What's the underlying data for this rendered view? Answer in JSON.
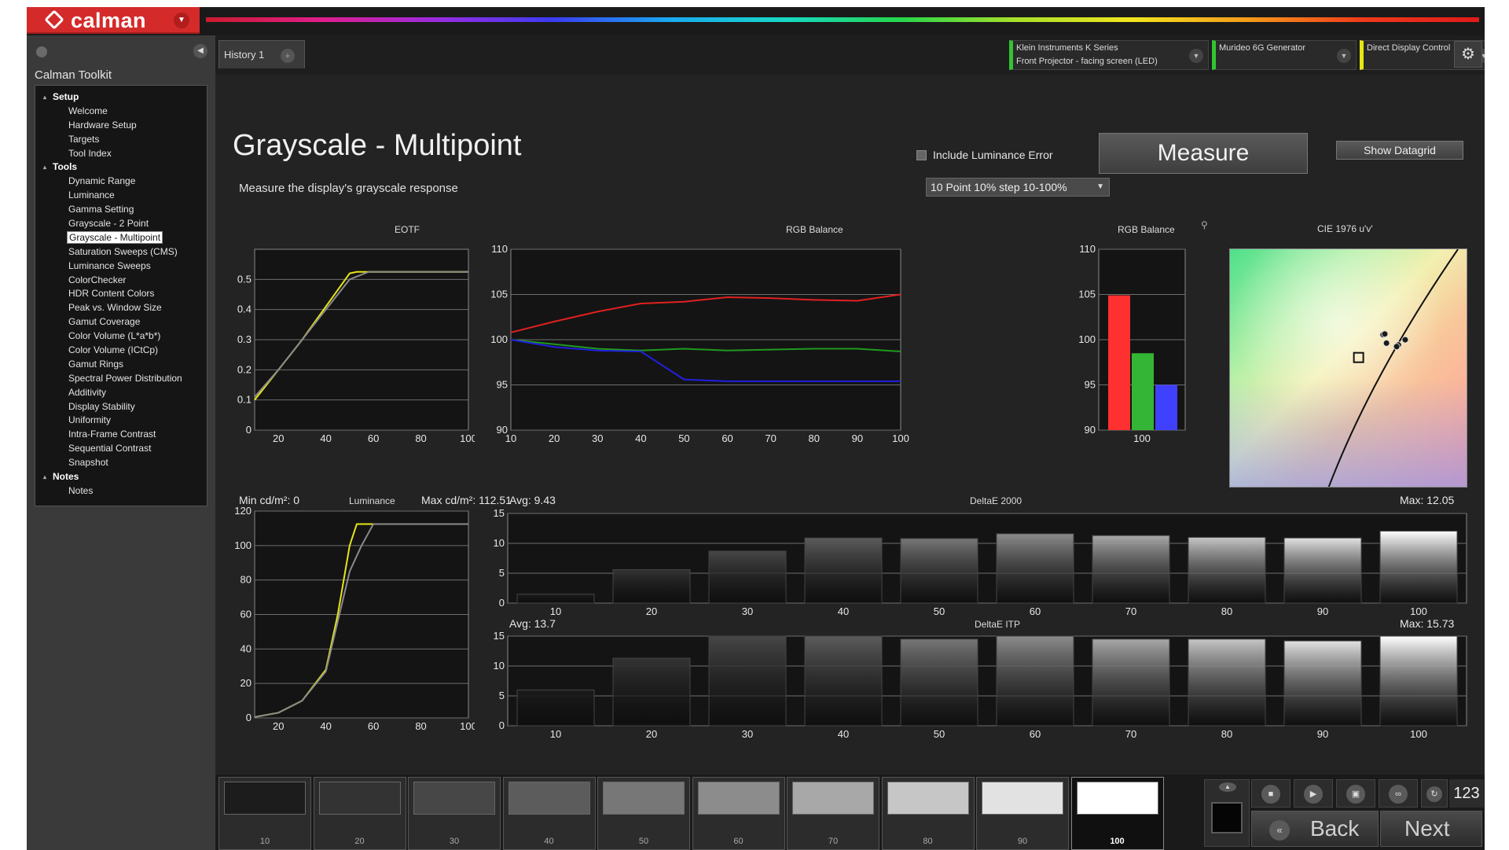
{
  "app": {
    "logo_text": "calman"
  },
  "toolkit": {
    "title": "Calman Toolkit",
    "groups": [
      {
        "label": "Setup",
        "items": [
          "Welcome",
          "Hardware Setup",
          "Targets",
          "Tool Index"
        ]
      },
      {
        "label": "Tools",
        "items": [
          "Dynamic Range",
          "Luminance",
          "Gamma Setting",
          "Grayscale - 2 Point",
          "Grayscale - Multipoint",
          "Saturation Sweeps (CMS)",
          "Luminance Sweeps",
          "ColorChecker",
          "HDR Content Colors",
          "Peak vs. Window Size",
          "Gamut Coverage",
          "Color Volume (L*a*b*)",
          "Color Volume (ICtCp)",
          "Gamut Rings",
          "Spectral Power Distribution",
          "Additivity",
          "Display Stability",
          "Uniformity",
          "Intra-Frame Contrast",
          "Sequential Contrast",
          "Snapshot"
        ]
      },
      {
        "label": "Notes",
        "items": [
          "Notes"
        ]
      }
    ],
    "selected": "Grayscale - Multipoint"
  },
  "tabs": {
    "history": "History 1",
    "add": "+"
  },
  "devices": [
    {
      "line1": "Klein Instruments K Series",
      "line2": "Front Projector - facing screen (LED)",
      "color": "#31c531"
    },
    {
      "line1": "Murideo 6G Generator",
      "line2": "",
      "color": "#31c531"
    },
    {
      "line1": "Direct Display Control",
      "line2": "",
      "color": "#e6e617"
    }
  ],
  "page": {
    "title": "Grayscale - Multipoint",
    "subtitle": "Measure the display's grayscale response",
    "include_luminance_error": "Include Luminance Error",
    "measure_button": "Measure",
    "datagrid_button": "Show Datagrid",
    "point_select": "10 Point 10% step 10-100%"
  },
  "charts": {
    "eotf": {
      "title": "EOTF",
      "y_ticks": [
        "0",
        "0.1",
        "0.2",
        "0.3",
        "0.4",
        "0.5"
      ],
      "x_ticks": [
        "20",
        "40",
        "60",
        "80",
        "100"
      ]
    },
    "rgb_line": {
      "title": "RGB Balance",
      "y_ticks": [
        "90",
        "95",
        "100",
        "105",
        "110"
      ],
      "x_ticks": [
        "10",
        "20",
        "30",
        "40",
        "50",
        "60",
        "70",
        "80",
        "90",
        "100"
      ]
    },
    "rgb_bar": {
      "title": "RGB Balance",
      "y_ticks": [
        "90",
        "95",
        "100",
        "105",
        "110"
      ],
      "x_tick": "100"
    },
    "cie": {
      "title": "CIE 1976 u'v'"
    },
    "luminance": {
      "title": "Luminance",
      "min_label": "Min cd/m²: 0",
      "max_label": "Max cd/m²: 112.51",
      "y_ticks": [
        "0",
        "20",
        "40",
        "60",
        "80",
        "100",
        "120"
      ],
      "x_ticks": [
        "20",
        "40",
        "60",
        "80",
        "100"
      ]
    },
    "de2000": {
      "title": "DeltaE 2000",
      "avg": "Avg: 9.43",
      "max": "Max: 12.05",
      "y_ticks": [
        "0",
        "5",
        "10",
        "15"
      ]
    },
    "deitp": {
      "title": "DeltaE ITP",
      "avg": "Avg: 13.7",
      "max": "Max: 15.73",
      "y_ticks": [
        "0",
        "5",
        "10",
        "15"
      ]
    }
  },
  "chart_data": [
    {
      "type": "line",
      "title": "EOTF",
      "xlim": [
        10,
        100
      ],
      "ylim": [
        0,
        0.6
      ],
      "series": [
        {
          "color": "#e6e619",
          "x": [
            10,
            20,
            30,
            40,
            50,
            53,
            60,
            70,
            80,
            90,
            100
          ],
          "y": [
            0.1,
            0.2,
            0.3,
            0.41,
            0.52,
            0.525,
            0.525,
            0.525,
            0.525,
            0.525,
            0.525
          ]
        },
        {
          "color": "#8a8a8a",
          "x": [
            10,
            20,
            30,
            40,
            50,
            58,
            60,
            70,
            80,
            90,
            100
          ],
          "y": [
            0.11,
            0.2,
            0.3,
            0.4,
            0.5,
            0.525,
            0.525,
            0.525,
            0.525,
            0.525,
            0.525
          ]
        }
      ]
    },
    {
      "type": "line",
      "title": "RGB Balance",
      "xlim": [
        10,
        100
      ],
      "ylim": [
        90,
        110
      ],
      "series": [
        {
          "color": "#e02020",
          "x": [
            10,
            20,
            30,
            40,
            50,
            60,
            70,
            80,
            90,
            100
          ],
          "y": [
            100.8,
            102.0,
            103.1,
            104.0,
            104.2,
            104.7,
            104.6,
            104.4,
            104.3,
            105.0
          ]
        },
        {
          "color": "#1f9a1f",
          "x": [
            10,
            20,
            30,
            40,
            50,
            60,
            70,
            80,
            90,
            100
          ],
          "y": [
            100.0,
            99.5,
            99.0,
            98.8,
            99.0,
            98.8,
            98.9,
            99.0,
            99.0,
            98.7
          ]
        },
        {
          "color": "#2020e0",
          "x": [
            10,
            20,
            30,
            40,
            50,
            60,
            70,
            80,
            90,
            100
          ],
          "y": [
            100.0,
            99.2,
            98.8,
            98.7,
            95.6,
            95.4,
            95.4,
            95.4,
            95.4,
            95.4
          ]
        }
      ]
    },
    {
      "type": "bar",
      "title": "RGB Balance",
      "categories": [
        "100"
      ],
      "ylim": [
        90,
        110
      ],
      "series": [
        {
          "color": "#ff3030",
          "values": [
            104.9
          ]
        },
        {
          "color": "#35b535",
          "values": [
            98.5
          ]
        },
        {
          "color": "#4040ff",
          "values": [
            95.0
          ]
        }
      ]
    },
    {
      "type": "scatter",
      "title": "CIE 1976 u'v'",
      "target": {
        "u": 0.1978,
        "v": 0.4683
      },
      "points": [
        [
          0.205,
          0.475
        ],
        [
          0.2055,
          0.4752
        ],
        [
          0.206,
          0.4725
        ],
        [
          0.2095,
          0.472
        ],
        [
          0.209,
          0.4715
        ],
        [
          0.2115,
          0.4735
        ]
      ]
    },
    {
      "type": "line",
      "title": "Luminance",
      "xlim": [
        10,
        100
      ],
      "ylim": [
        0,
        120
      ],
      "series": [
        {
          "color": "#e6e619",
          "x": [
            10,
            20,
            30,
            40,
            45,
            50,
            53,
            60,
            70,
            80,
            90,
            100
          ],
          "y": [
            0.5,
            3,
            10,
            28,
            60,
            100,
            112.5,
            112.5,
            112.5,
            112.5,
            112.5,
            112.5
          ]
        },
        {
          "color": "#8a8a8a",
          "x": [
            10,
            20,
            30,
            40,
            50,
            55,
            60,
            70,
            80,
            90,
            100
          ],
          "y": [
            0.5,
            3,
            10,
            27,
            85,
            100,
            112.5,
            112.5,
            112.5,
            112.5,
            112.5
          ]
        }
      ]
    },
    {
      "type": "bar",
      "title": "DeltaE 2000",
      "categories": [
        "10",
        "20",
        "30",
        "40",
        "50",
        "60",
        "70",
        "80",
        "90",
        "100"
      ],
      "ylim": [
        0,
        15
      ],
      "values": [
        1.5,
        5.6,
        8.7,
        10.9,
        10.8,
        11.6,
        11.3,
        11.0,
        10.9,
        12.05
      ]
    },
    {
      "type": "bar",
      "title": "DeltaE ITP",
      "categories": [
        "10",
        "20",
        "30",
        "40",
        "50",
        "60",
        "70",
        "80",
        "90",
        "100"
      ],
      "ylim": [
        0,
        15
      ],
      "values": [
        6.0,
        11.3,
        15.0,
        15.0,
        14.5,
        15.0,
        14.5,
        14.5,
        14.2,
        15.73
      ]
    }
  ],
  "swatches": [
    {
      "label": "10",
      "color": "#1c1c1c"
    },
    {
      "label": "20",
      "color": "#333333"
    },
    {
      "label": "30",
      "color": "#474747"
    },
    {
      "label": "40",
      "color": "#5c5c5c"
    },
    {
      "label": "50",
      "color": "#777777"
    },
    {
      "label": "60",
      "color": "#8c8c8c"
    },
    {
      "label": "70",
      "color": "#a8a8a8"
    },
    {
      "label": "80",
      "color": "#c6c6c6"
    },
    {
      "label": "90",
      "color": "#e2e2e2"
    },
    {
      "label": "100",
      "color": "#ffffff"
    }
  ],
  "selected_swatch": "100",
  "controls": {
    "counter": "123",
    "back": "Back",
    "next": "Next"
  }
}
